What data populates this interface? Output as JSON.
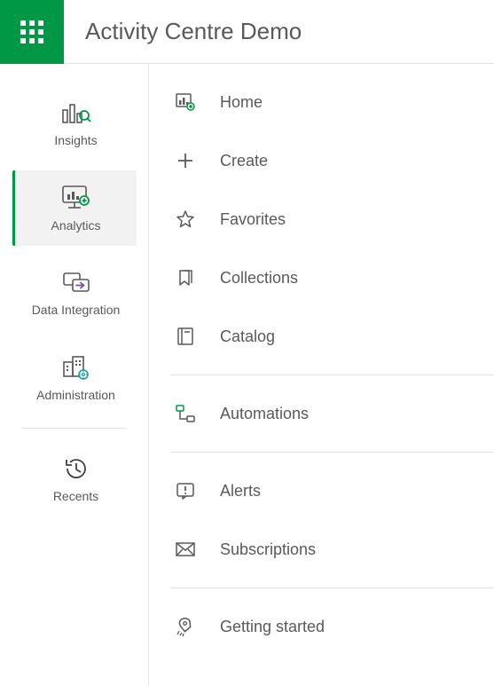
{
  "header": {
    "title": "Activity Centre Demo"
  },
  "sidebar": {
    "items": [
      {
        "label": "Insights"
      },
      {
        "label": "Analytics"
      },
      {
        "label": "Data Integration"
      },
      {
        "label": "Administration"
      },
      {
        "label": "Recents"
      }
    ],
    "selected_index": 1
  },
  "menu": {
    "groups": [
      [
        {
          "label": "Home"
        },
        {
          "label": "Create"
        },
        {
          "label": "Favorites"
        },
        {
          "label": "Collections"
        },
        {
          "label": "Catalog"
        }
      ],
      [
        {
          "label": "Automations"
        }
      ],
      [
        {
          "label": "Alerts"
        },
        {
          "label": "Subscriptions"
        }
      ],
      [
        {
          "label": "Getting started"
        }
      ]
    ]
  }
}
